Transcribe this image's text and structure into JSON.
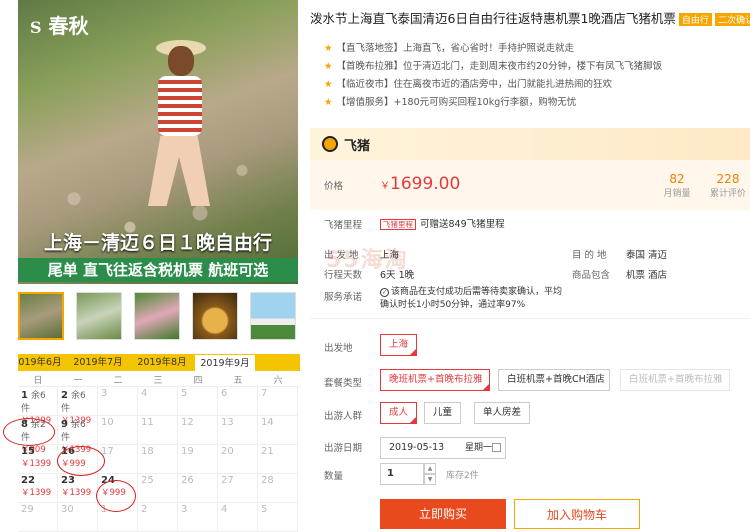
{
  "gallery": {
    "logo": "春秋",
    "title_line1": "上海－清迈６日１晚自由行",
    "title_line2": "尾单 直飞往返含税机票 航班可选"
  },
  "calendar": {
    "tabs": [
      "019年6月",
      "2019年7月",
      "2019年8月",
      "2019年9月"
    ],
    "weekdays": [
      "日",
      "一",
      "二",
      "三",
      "四",
      "五",
      "六"
    ],
    "days": [
      {
        "d": "1",
        "rem": "余6件",
        "price": "￥1399",
        "active": true
      },
      {
        "d": "2",
        "rem": "余6件",
        "price": "￥1399",
        "active": true
      },
      {
        "d": "3"
      },
      {
        "d": "4"
      },
      {
        "d": "5"
      },
      {
        "d": "6"
      },
      {
        "d": "7"
      },
      {
        "d": "8",
        "rem": "余2件",
        "price": "￥909",
        "active": true
      },
      {
        "d": "9",
        "rem": "余6件",
        "price": "￥1399",
        "active": true
      },
      {
        "d": "10"
      },
      {
        "d": "11"
      },
      {
        "d": "12"
      },
      {
        "d": "13"
      },
      {
        "d": "14"
      },
      {
        "d": "15",
        "price": "￥1399",
        "active": true
      },
      {
        "d": "16",
        "price": "￥999",
        "active": true
      },
      {
        "d": "17"
      },
      {
        "d": "18"
      },
      {
        "d": "19"
      },
      {
        "d": "20"
      },
      {
        "d": "21"
      },
      {
        "d": "22",
        "price": "￥1399",
        "active": true
      },
      {
        "d": "23",
        "price": "￥1399",
        "active": true
      },
      {
        "d": "24",
        "price": "￥999",
        "active": true
      },
      {
        "d": "25"
      },
      {
        "d": "26"
      },
      {
        "d": "27"
      },
      {
        "d": "28"
      },
      {
        "d": "29"
      },
      {
        "d": "30"
      },
      {
        "d": "1"
      },
      {
        "d": "2"
      },
      {
        "d": "3"
      },
      {
        "d": "4"
      },
      {
        "d": "5"
      }
    ]
  },
  "product": {
    "title": "泼水节上海直飞泰国清迈6日自由行往返特惠机票1晚酒店飞猪机票",
    "tags": [
      "自由行",
      "二次确认"
    ],
    "features": [
      "【直飞落地签】上海直飞，省心省时！手持护照说走就走",
      "【首晚布拉雅】位于清迈北门，走到周末夜市约20分钟，楼下有凤飞飞猪脚饭",
      "【临近夜市】住在离夜市近的酒店旁中，出门就能扎进热闹的狂欢",
      "【增值服务】+180元可购买回程10kg行李额，购物无忧"
    ],
    "brand": "飞猪",
    "price_label": "价格",
    "price_symbol": "￥",
    "price": "1699.00",
    "sales": "82",
    "sales_label": "月销量",
    "reviews": "228",
    "reviews_label": "累计评价",
    "mileage_label": "飞猪里程",
    "mileage_badge": "飞猪里程",
    "mileage_text": "可赠送849飞猪里程",
    "depart_label": "出 发 地",
    "depart": "上海",
    "dest_label": "目 的 地",
    "dest": "泰国 清迈",
    "days_label": "行程天数",
    "days": "6天 1晚",
    "includes_label": "商品包含",
    "includes": "机票 酒店",
    "promise_label": "服务承诺",
    "promise": "该商品在支付成功后需等待卖家确认，平均确认时长1小时50分钟，通过率97%",
    "watermark": "55海淘"
  },
  "options": {
    "from_label": "出发地",
    "from": "上海",
    "package_label": "套餐类型",
    "packages": [
      "晚班机票+首晚布拉雅",
      "白班机票+首晚CH酒店",
      "白班机票+首晚布拉雅"
    ],
    "people_label": "出游人群",
    "people": [
      "成人",
      "儿童",
      "单人房差"
    ],
    "date_label": "出游日期",
    "date": "2019-05-13",
    "weekday": "星期一",
    "qty_label": "数量",
    "qty": "1",
    "stock": "库存2件",
    "buy": "立即购买",
    "cart": "加入购物车"
  }
}
